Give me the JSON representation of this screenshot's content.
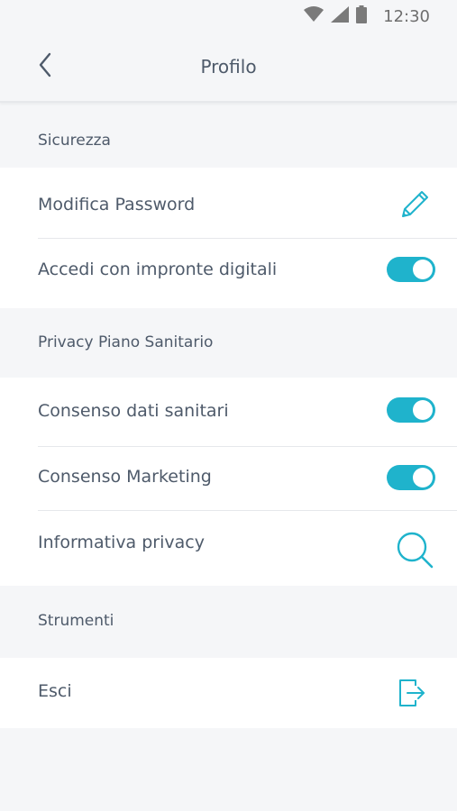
{
  "status_bar": {
    "time": "12:30",
    "icons": [
      "wifi-icon",
      "signal-icon",
      "battery-icon"
    ]
  },
  "header": {
    "title": "Profilo",
    "back_icon": "chevron-left-icon"
  },
  "colors": {
    "accent": "#1fb3cc",
    "text": "#4e5a6a",
    "background": "#f5f6f8"
  },
  "sections": {
    "security": {
      "label": "Sicurezza",
      "items": {
        "change_password": {
          "label": "Modifica Password",
          "icon": "pencil-icon"
        },
        "fingerprint_login": {
          "label": "Accedi con impronte digitali",
          "toggle": true
        }
      }
    },
    "privacy": {
      "label": "Privacy Piano Sanitario",
      "items": {
        "health_data_consent": {
          "label": "Consenso dati sanitari",
          "toggle": true
        },
        "marketing_consent": {
          "label": "Consenso Marketing",
          "toggle": true
        },
        "privacy_policy": {
          "label": "Informativa privacy",
          "icon": "search-icon"
        }
      }
    },
    "tools": {
      "label": "Strumenti",
      "items": {
        "logout": {
          "label": "Esci",
          "icon": "logout-icon"
        }
      }
    }
  }
}
